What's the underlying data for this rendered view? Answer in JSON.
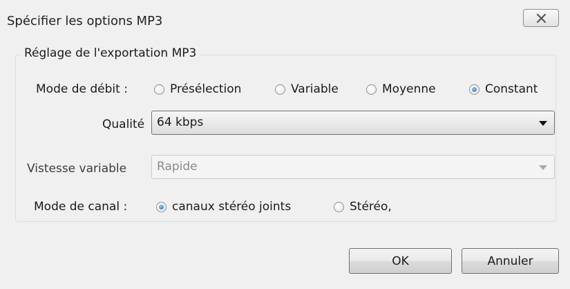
{
  "window": {
    "title": "Spécifier les options MP3"
  },
  "group": {
    "legend": "Réglage de l'exportation MP3"
  },
  "bitrate_mode": {
    "label": "Mode de débit :",
    "options": [
      {
        "label": "Présélection",
        "checked": false
      },
      {
        "label": "Variable",
        "checked": false
      },
      {
        "label": "Moyenne",
        "checked": false
      },
      {
        "label": "Constant",
        "checked": true
      }
    ]
  },
  "quality": {
    "label": "Qualité",
    "selected": "64 kbps"
  },
  "variable_speed": {
    "label": "Vistesse variable",
    "selected": "Rapide",
    "enabled": false
  },
  "channel_mode": {
    "label": "Mode de canal :",
    "options": [
      {
        "label": "canaux stéréo joints",
        "checked": true
      },
      {
        "label": "Stéréo,",
        "checked": false
      }
    ]
  },
  "buttons": {
    "ok": "OK",
    "cancel": "Annuler"
  },
  "icons": {
    "close": "close-icon"
  }
}
